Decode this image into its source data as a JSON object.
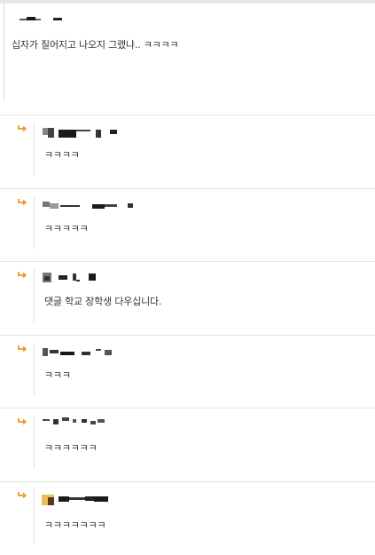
{
  "main_comment": {
    "text": "십자가 질어지고 나오지 그랬냐.. ㅋㅋㅋㅋ"
  },
  "replies": [
    {
      "text": "ㅋㅋㅋㅋ"
    },
    {
      "text": "ㅋㅋㅋㅋㅋ"
    },
    {
      "text": "댓글 학교 장학생 다우십니다."
    },
    {
      "text": "ㅋㅋㅋ"
    },
    {
      "text": "ㅋㅋㅋㅋㅋㅋ"
    },
    {
      "text": "ㅋㅋㅋㅋㅋㅋㅋ"
    }
  ],
  "colors": {
    "reply_arrow": "#e89b2b",
    "divider": "#e5e5e5"
  },
  "icons": {
    "reply": "reply-arrow-icon"
  }
}
